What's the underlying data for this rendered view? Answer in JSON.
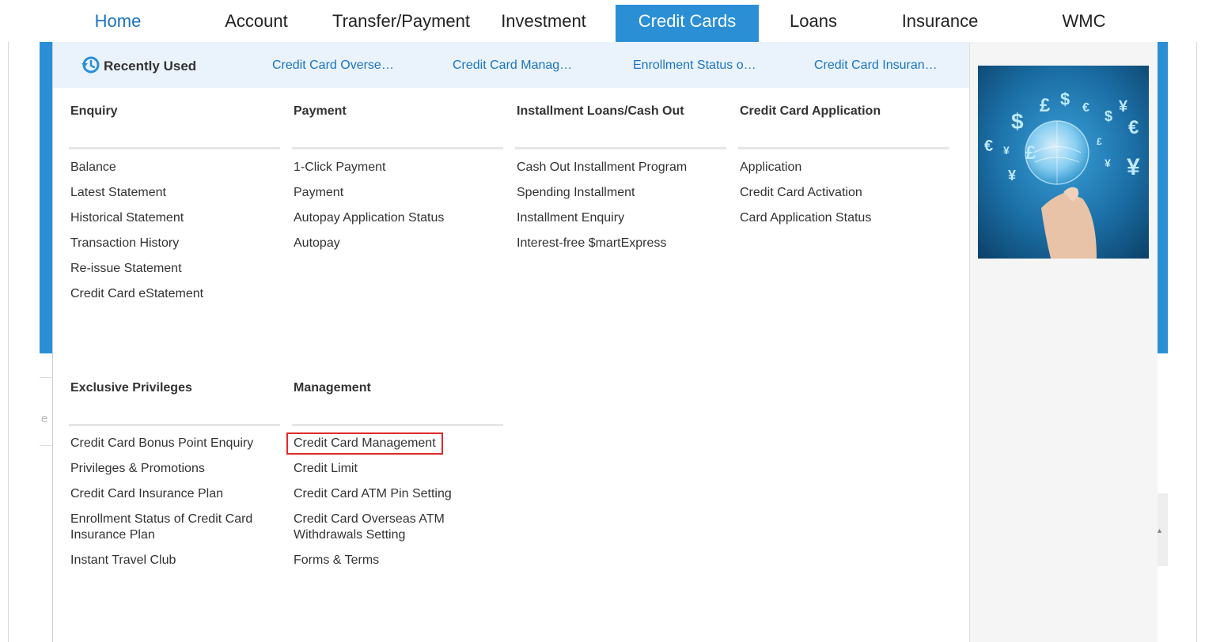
{
  "nav": {
    "items": [
      {
        "label": "Home"
      },
      {
        "label": "Account"
      },
      {
        "label": "Transfer/Payment"
      },
      {
        "label": "Investment"
      },
      {
        "label": "Credit Cards"
      },
      {
        "label": "Loans"
      },
      {
        "label": "Insurance"
      },
      {
        "label": "WMC"
      }
    ],
    "active": "Credit Cards"
  },
  "recently_used": {
    "title": "Recently Used",
    "links": [
      "Credit Card Overse…",
      "Credit Card Manag…",
      "Enrollment Status o…",
      "Credit Card Insuran…"
    ]
  },
  "columns": {
    "enquiry": {
      "title": "Enquiry",
      "items": [
        "Balance",
        "Latest Statement",
        "Historical Statement",
        "Transaction History",
        "Re-issue Statement",
        "Credit Card eStatement"
      ]
    },
    "payment": {
      "title": "Payment",
      "items": [
        "1-Click Payment",
        "Payment",
        "Autopay Application Status",
        "Autopay"
      ]
    },
    "installment": {
      "title": "Installment Loans/Cash Out",
      "items": [
        "Cash Out Installment Program",
        "Spending Installment",
        "Installment Enquiry",
        "Interest-free $martExpress"
      ]
    },
    "application": {
      "title": "Credit Card Application",
      "items": [
        "Application",
        "Credit Card Activation",
        "Card Application Status"
      ]
    },
    "privileges": {
      "title": "Exclusive Privileges",
      "items": [
        "Credit Card Bonus Point Enquiry",
        "Privileges & Promotions",
        "Credit Card Insurance Plan",
        "Enrollment Status of Credit Card Insurance Plan",
        "Instant Travel Club"
      ]
    },
    "management": {
      "title": "Management",
      "items": [
        "Credit Card Management",
        "Credit Limit",
        "Credit Card ATM Pin Setting",
        "Credit Card Overseas ATM Withdrawals Setting",
        "Forms & Terms"
      ]
    }
  },
  "background": {
    "ghost_text": "e"
  },
  "colors": {
    "accent": "#2b8fd6",
    "link": "#1a73c2",
    "highlight_box": "#e02a2a",
    "recent_bar": "#eaf3fb"
  },
  "icons": {
    "recent": "history-icon",
    "promo": "currency-lightbulb-image"
  }
}
